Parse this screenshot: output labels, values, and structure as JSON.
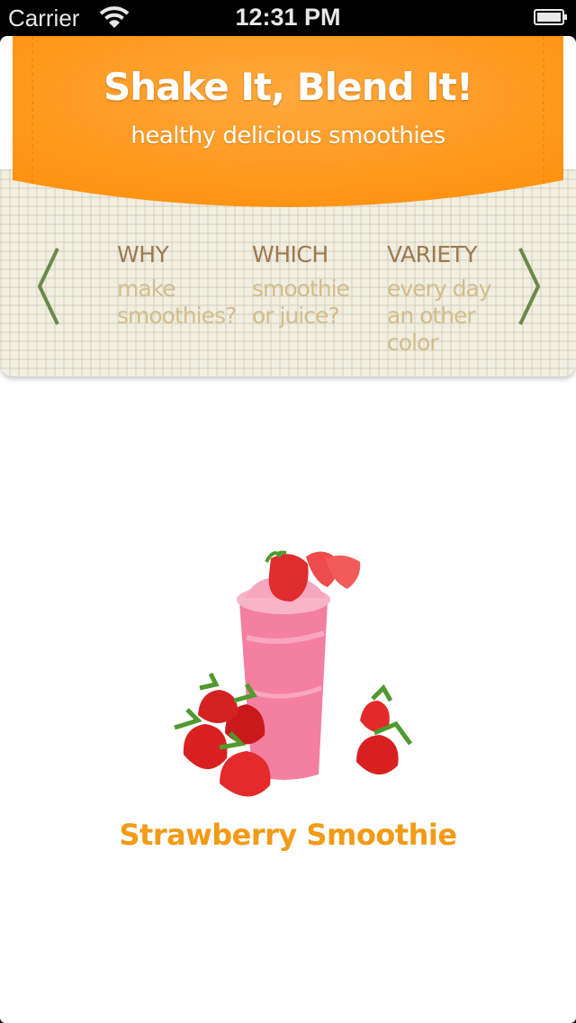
{
  "status_bar": {
    "carrier": "Carrier",
    "time": "12:31 PM",
    "wifi_icon": "wifi-icon",
    "battery_icon": "battery-icon"
  },
  "header": {
    "title": "Shake It, Blend It!",
    "subtitle": "healthy delicious smoothies",
    "banner_color": "#ff9a1e"
  },
  "nav": {
    "prev_icon": "chevron-left-icon",
    "next_icon": "chevron-right-icon",
    "arrow_color": "#6a8a48",
    "items": [
      {
        "title": "WHY",
        "lines": [
          "make",
          "smoothies?"
        ]
      },
      {
        "title": "WHICH",
        "lines": [
          "smoothie",
          "or juice?"
        ]
      },
      {
        "title": "VARIETY",
        "lines": [
          "every day",
          "an other",
          "color"
        ]
      }
    ]
  },
  "product": {
    "name": "Strawberry Smoothie",
    "image": "strawberry-smoothie-image",
    "name_color": "#f39a16"
  }
}
